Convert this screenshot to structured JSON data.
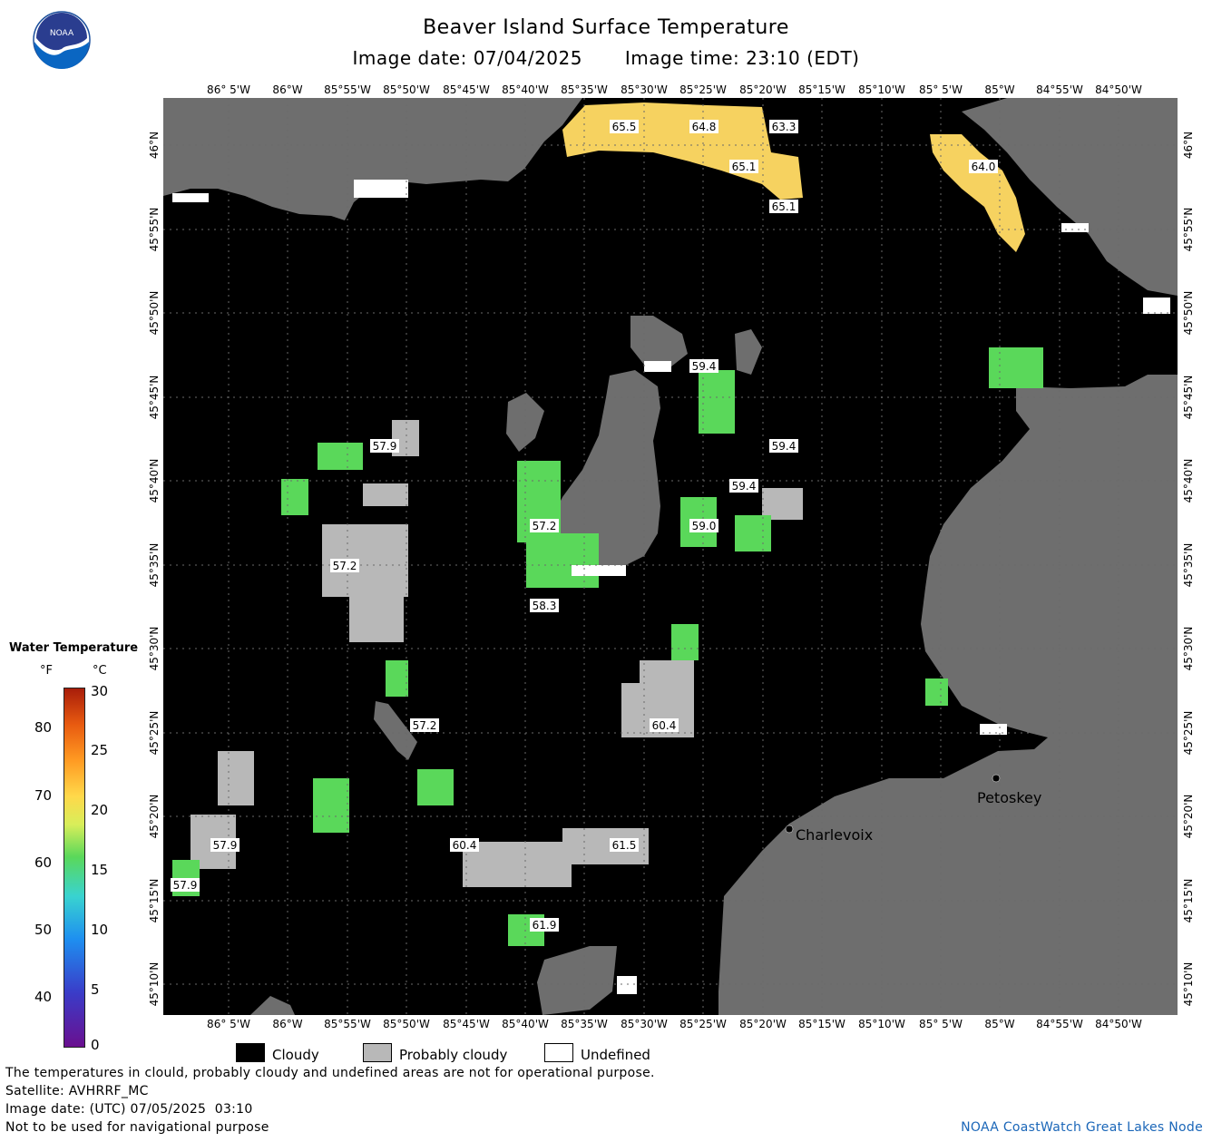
{
  "header": {
    "title": "Beaver Island Surface Temperature",
    "image_date_label": "Image date: 07/04/2025",
    "image_time_label": "Image time: 23:10 (EDT)"
  },
  "logo": {
    "text": "NOAA",
    "icon": "noaa-logo-icon"
  },
  "map": {
    "lon_labels": [
      "86° 5'W",
      "86°W",
      "85°55'W",
      "85°50'W",
      "85°45'W",
      "85°40'W",
      "85°35'W",
      "85°30'W",
      "85°25'W",
      "85°20'W",
      "85°15'W",
      "85°10'W",
      "85° 5'W",
      "85°W",
      "84°55'W",
      "84°50'W"
    ],
    "lat_labels": [
      "46°N",
      "45°55'N",
      "45°50'N",
      "45°45'N",
      "45°40'N",
      "45°35'N",
      "45°30'N",
      "45°25'N",
      "45°20'N",
      "45°15'N",
      "45°10'N"
    ],
    "cities": [
      {
        "name": "Charlevoix"
      },
      {
        "name": "Petoskey"
      }
    ],
    "temperature_labels": [
      "65.5",
      "64.8",
      "63.3",
      "65.1",
      "65.1",
      "64.0",
      "59.4",
      "57.9",
      "59.4",
      "59.4",
      "57.2",
      "59.0",
      "57.2",
      "58.3",
      "57.2",
      "60.4",
      "57.9",
      "57.9",
      "60.4",
      "61.5",
      "61.9"
    ],
    "colors": {
      "cloudy": "#000000",
      "probably_cloudy": "#b8b8b8",
      "undefined": "#ffffff",
      "land": "#6e6e6e"
    }
  },
  "legend": {
    "title": "Water Temperature",
    "unit_f": "°F",
    "unit_c": "°C",
    "f_ticks": [
      "80",
      "70",
      "60",
      "50",
      "40"
    ],
    "c_ticks": [
      "30",
      "25",
      "20",
      "15",
      "10",
      "5",
      "0"
    ]
  },
  "key": {
    "cloudy": "Cloudy",
    "probably_cloudy": "Probably cloudy",
    "undefined": "Undefined"
  },
  "footer": {
    "disclaimer": "The temperatures in clould, probably cloudy and undefined areas are not for operational purpose.",
    "satellite": "Satellite: AVHRRF_MC",
    "utc_date": "Image date: (UTC) 07/05/2025  03:10",
    "navigation": "Not to be used for navigational purpose",
    "credit": "NOAA CoastWatch Great Lakes Node"
  }
}
